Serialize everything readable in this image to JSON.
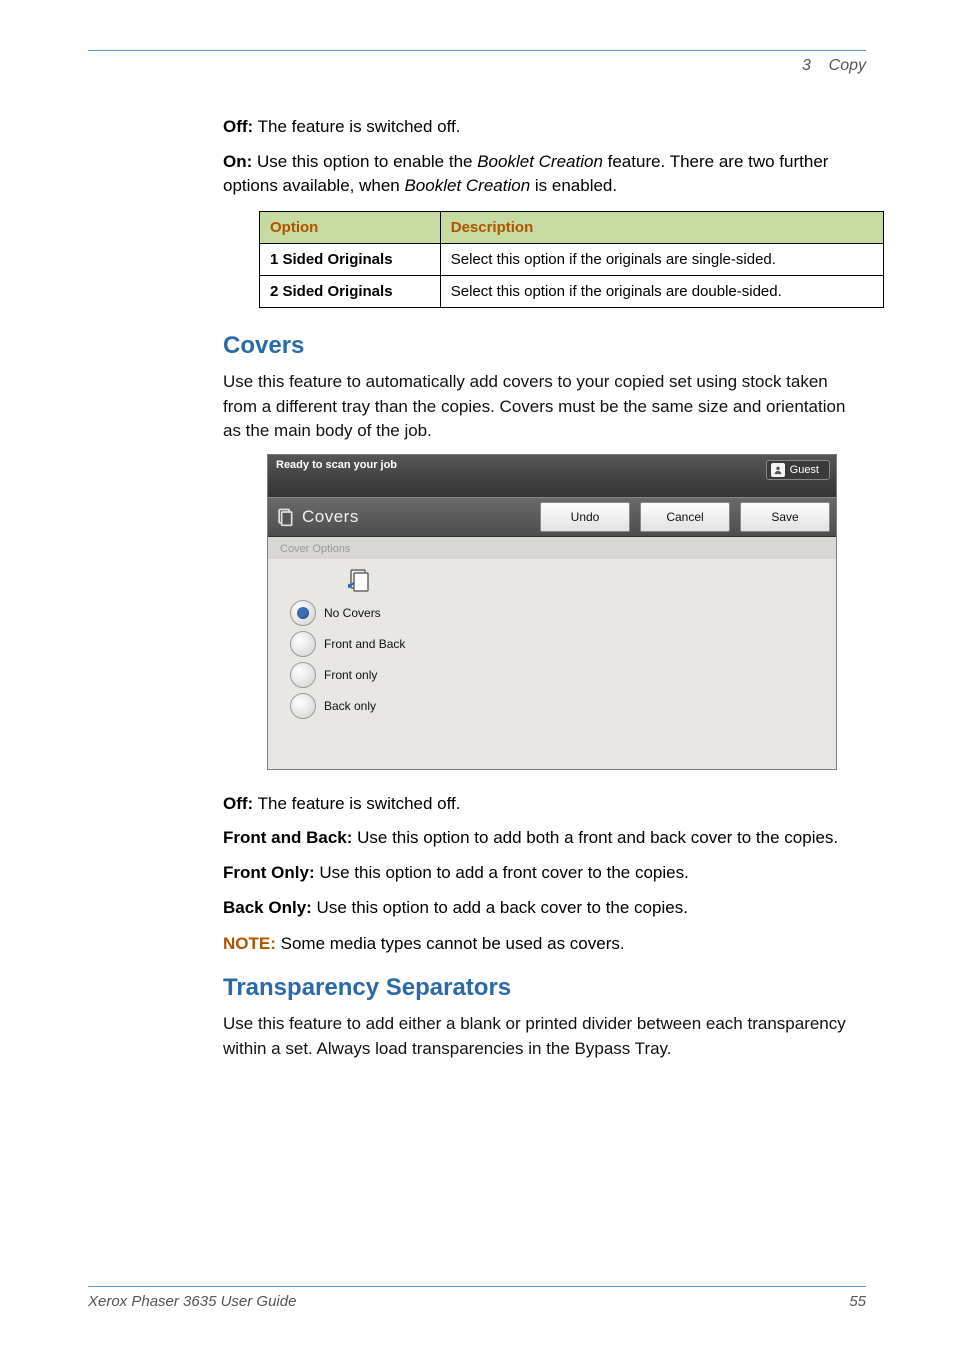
{
  "header": {
    "chapter_num": "3",
    "chapter_title": "Copy"
  },
  "para_off_label": "Off:",
  "para_off_text": " The feature is switched off.",
  "para_on_label": "On:",
  "para_on_text_1": " Use this option to enable the ",
  "para_on_em": "Booklet Creation",
  "para_on_text_2": " feature. There are two further options available, when ",
  "para_on_em2": "Booklet Creation",
  "para_on_text_3": " is enabled.",
  "table": {
    "th_option": "Option",
    "th_desc": "Description",
    "rows": [
      {
        "opt": "1 Sided Originals",
        "desc": "Select this option if the originals are single-sided."
      },
      {
        "opt": "2 Sided Originals",
        "desc": "Select this option if the originals are double-sided."
      }
    ]
  },
  "covers": {
    "title": "Covers",
    "intro": "Use this feature to automatically add covers to your copied set using stock taken from a different tray than the copies. Covers must be the same size and orientation as the main body of the job."
  },
  "ui": {
    "status": "Ready to scan your job",
    "guest": "Guest",
    "panel_title": "Covers",
    "btn_undo": "Undo",
    "btn_cancel": "Cancel",
    "btn_save": "Save",
    "group_label": "Cover Options",
    "radio1": "No Covers",
    "radio2": "Front and Back",
    "radio3": "Front only",
    "radio4": "Back only"
  },
  "covers_off_label": "Off:",
  "covers_off_text": " The feature is switched off.",
  "fb_label": "Front and Back:",
  "fb_text": " Use this option to add both a front and back cover to the copies.",
  "fo_label": "Front Only:",
  "fo_text": " Use this option to add a front cover to the copies.",
  "bo_label": "Back Only:",
  "bo_text": " Use this option to add a back cover to the copies.",
  "note_label": "NOTE:",
  "note_text": " Some media types cannot be used as covers.",
  "transparency": {
    "title": "Transparency Separators",
    "text": "Use this feature to add either a blank or printed divider between each transparency within a set. Always load transparencies in the Bypass Tray."
  },
  "footer": {
    "left": "Xerox Phaser 3635 User Guide",
    "right": "55"
  }
}
